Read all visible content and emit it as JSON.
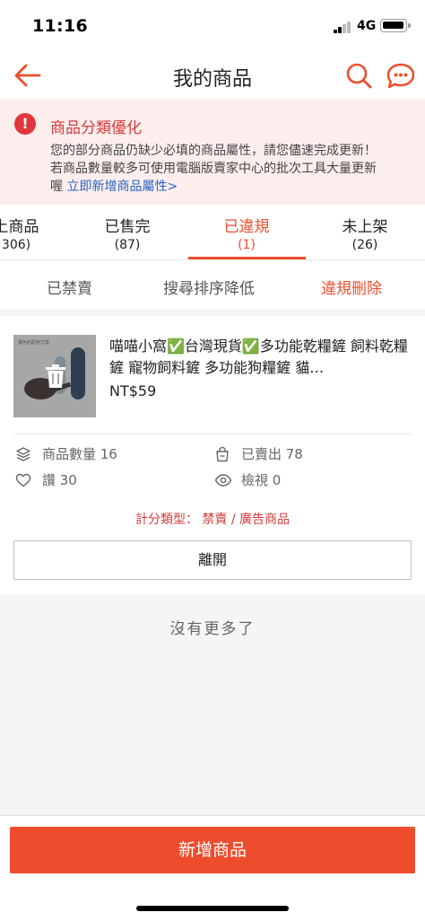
{
  "status_bar": {
    "time": "11:16",
    "network": "4G"
  },
  "nav": {
    "title": "我的商品",
    "icons": [
      "back-arrow-icon",
      "search-icon",
      "chat-icon"
    ]
  },
  "notice": {
    "title": "商品分類優化",
    "line1": "您的部分商品仍缺少必填的商品屬性，請您儘速完成更新！",
    "line2": "若商品數量較多可使用電腦版賣家中心的批次工具大量更新",
    "line3_prefix": "喔",
    "link": "立即新增商品屬性>"
  },
  "tabs": [
    {
      "label": "上商品",
      "count": "306)"
    },
    {
      "label": "已售完",
      "count": "(87)"
    },
    {
      "label": "已違規",
      "count": "(1)"
    },
    {
      "label": "未上架",
      "count": "(26)"
    }
  ],
  "subtabs": [
    "已禁賣",
    "搜尋排序降低",
    "違規刪除"
  ],
  "product": {
    "image_caption": "優色的配色方案",
    "name": "喵喵小窩✅台灣現貨✅多功能乾糧鏟 飼料乾糧鏟 寵物飼料鏟 多功能狗糧鏟 貓…",
    "price": "NT$59",
    "stats": {
      "quantity": "商品數量 16",
      "sold": "已賣出 78",
      "likes": "讚 30",
      "views": "檢視 0"
    },
    "violation": "計分類型： 禁賣 / 廣告商品",
    "leave_button": "離開"
  },
  "no_more": "沒有更多了",
  "add_button": "新增商品",
  "colors": {
    "accent": "#ee4d2d",
    "alert": "#d63b3b",
    "link": "#2a62c9",
    "notice_bg": "#fdeeee"
  }
}
